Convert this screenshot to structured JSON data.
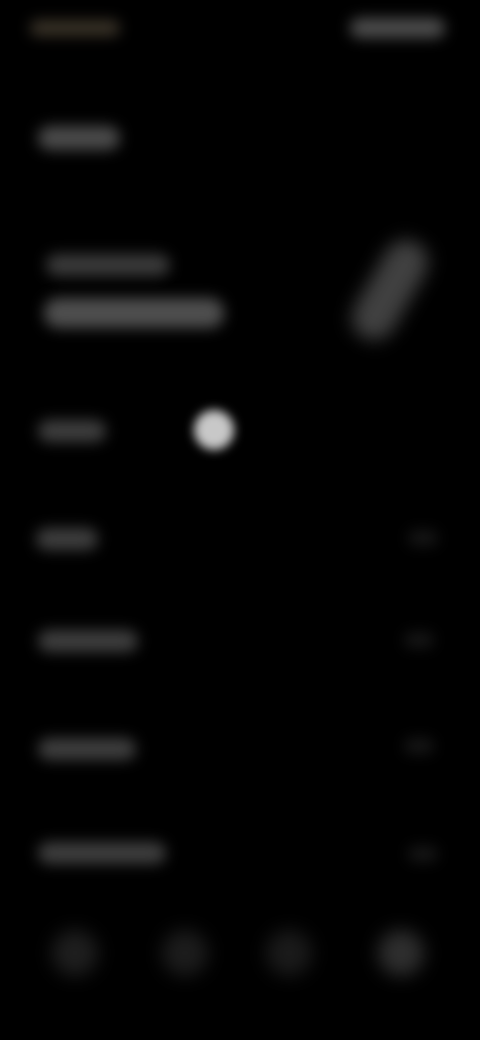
{
  "theme": {
    "background": "#000000",
    "glow": "#4e4e4e",
    "indicator": "#c8c8c8"
  },
  "status_bar": {
    "left_text": "",
    "right_text": ""
  },
  "header": {
    "title": ""
  },
  "hero": {
    "line1": "",
    "line2": "",
    "art_icon": "illustration-icon"
  },
  "page_indicator": {
    "icon": "dot-icon"
  },
  "list": {
    "items": [
      {
        "label": "",
        "value": ""
      },
      {
        "label": "",
        "value": ""
      },
      {
        "label": "",
        "value": ""
      },
      {
        "label": "",
        "value": ""
      },
      {
        "label": "",
        "value": ""
      }
    ]
  },
  "tab_bar": {
    "tabs": [
      {
        "icon": "tab-icon"
      },
      {
        "icon": "tab-icon"
      },
      {
        "icon": "tab-icon"
      },
      {
        "icon": "tab-icon"
      }
    ]
  }
}
